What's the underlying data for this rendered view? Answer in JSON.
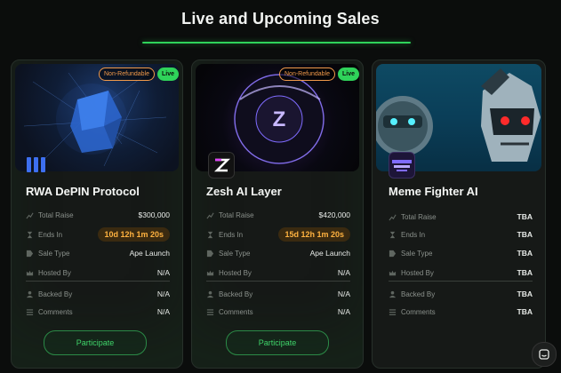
{
  "page": {
    "heading": "Live and Upcoming Sales"
  },
  "labels": {
    "total_raise": "Total Raise",
    "ends_in": "Ends In",
    "sale_type": "Sale Type",
    "hosted_by": "Hosted By",
    "backed_by": "Backed By",
    "comments": "Comments",
    "participate": "Participate",
    "non_refundable": "Non-Refundable",
    "live": "Live"
  },
  "cards": [
    {
      "name": "RWA DePIN Protocol",
      "total_raise": "$300,000",
      "ends_in": "10d 12h 1m 20s",
      "sale_type": "Ape Launch",
      "hosted_by": "N/A",
      "backed_by": "N/A",
      "comments": "N/A",
      "logo_icon": "bars-logo-icon",
      "status": "live"
    },
    {
      "name": "Zesh AI Layer",
      "total_raise": "$420,000",
      "ends_in": "15d 12h 1m 20s",
      "sale_type": "Ape Launch",
      "hosted_by": "N/A",
      "backed_by": "N/A",
      "comments": "N/A",
      "logo_icon": "z-logo-icon",
      "status": "live"
    },
    {
      "name": "Meme Fighter AI",
      "total_raise": "TBA",
      "ends_in": "TBA",
      "sale_type": "TBA",
      "hosted_by": "TBA",
      "backed_by": "TBA",
      "comments": "TBA",
      "logo_icon": "meme-fighter-logo-icon",
      "status": "upcoming"
    }
  ],
  "colors": {
    "accent": "#2fd35a",
    "timer": "#ffb240",
    "non_refundable": "#f29a4a"
  }
}
